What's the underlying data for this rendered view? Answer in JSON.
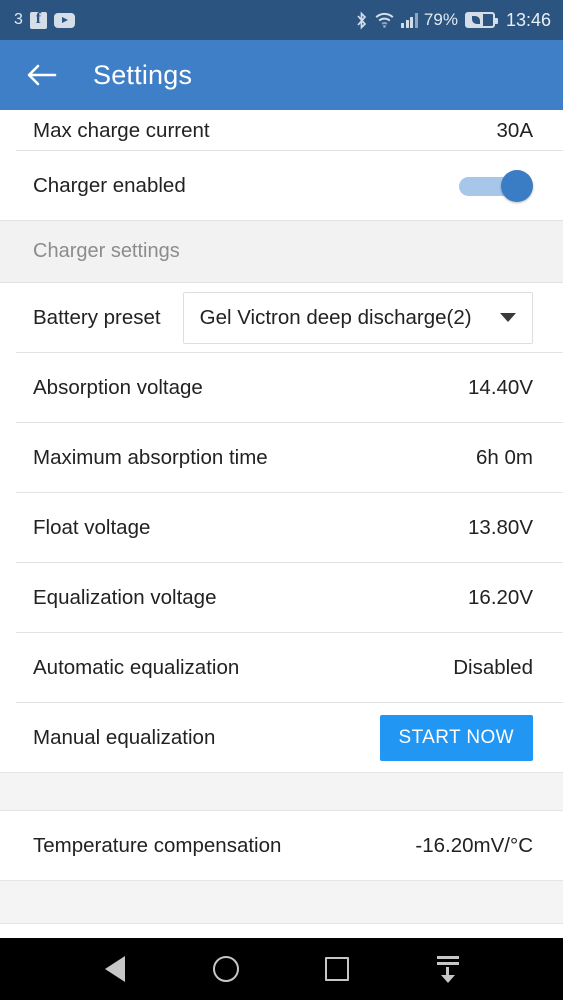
{
  "status_bar": {
    "notification_count": "3",
    "icons": [
      "facebook-icon",
      "youtube-icon",
      "bluetooth-icon",
      "wifi-icon",
      "signal-icon",
      "battery-saver-icon"
    ],
    "battery_percent": "79%",
    "time": "13:46",
    "background_color": "#2B5480"
  },
  "app_bar": {
    "back_label": "back-arrow",
    "title": "Settings",
    "background_color": "#3F7FC8"
  },
  "settings": {
    "max_charge_current": {
      "label": "Max charge current",
      "value": "30A"
    },
    "charger_enabled": {
      "label": "Charger enabled",
      "value": "on"
    },
    "section_charger": {
      "label": "Charger settings"
    },
    "battery_preset": {
      "label": "Battery preset",
      "value": "Gel Victron deep discharge(2)"
    },
    "absorption_voltage": {
      "label": "Absorption voltage",
      "value": "14.40V"
    },
    "max_absorption_time": {
      "label": "Maximum absorption time",
      "value": "6h 0m"
    },
    "float_voltage": {
      "label": "Float voltage",
      "value": "13.80V"
    },
    "equalization_voltage": {
      "label": "Equalization voltage",
      "value": "16.20V"
    },
    "automatic_equalization": {
      "label": "Automatic equalization",
      "value": "Disabled"
    },
    "manual_equalization": {
      "label": "Manual equalization",
      "button": "START NOW"
    },
    "temperature_compensation": {
      "label": "Temperature compensation",
      "value": "-16.20mV/°C"
    }
  },
  "colors": {
    "accent": "#2196F3",
    "app_bar": "#3F7FC8",
    "status_bar": "#2B5480",
    "toggle_on_thumb": "#3B7DC4",
    "toggle_on_track": "#A7C7EA"
  },
  "nav_bar": {
    "buttons": [
      "back-nav",
      "home-nav",
      "recents-nav",
      "pull-down-nav"
    ]
  }
}
